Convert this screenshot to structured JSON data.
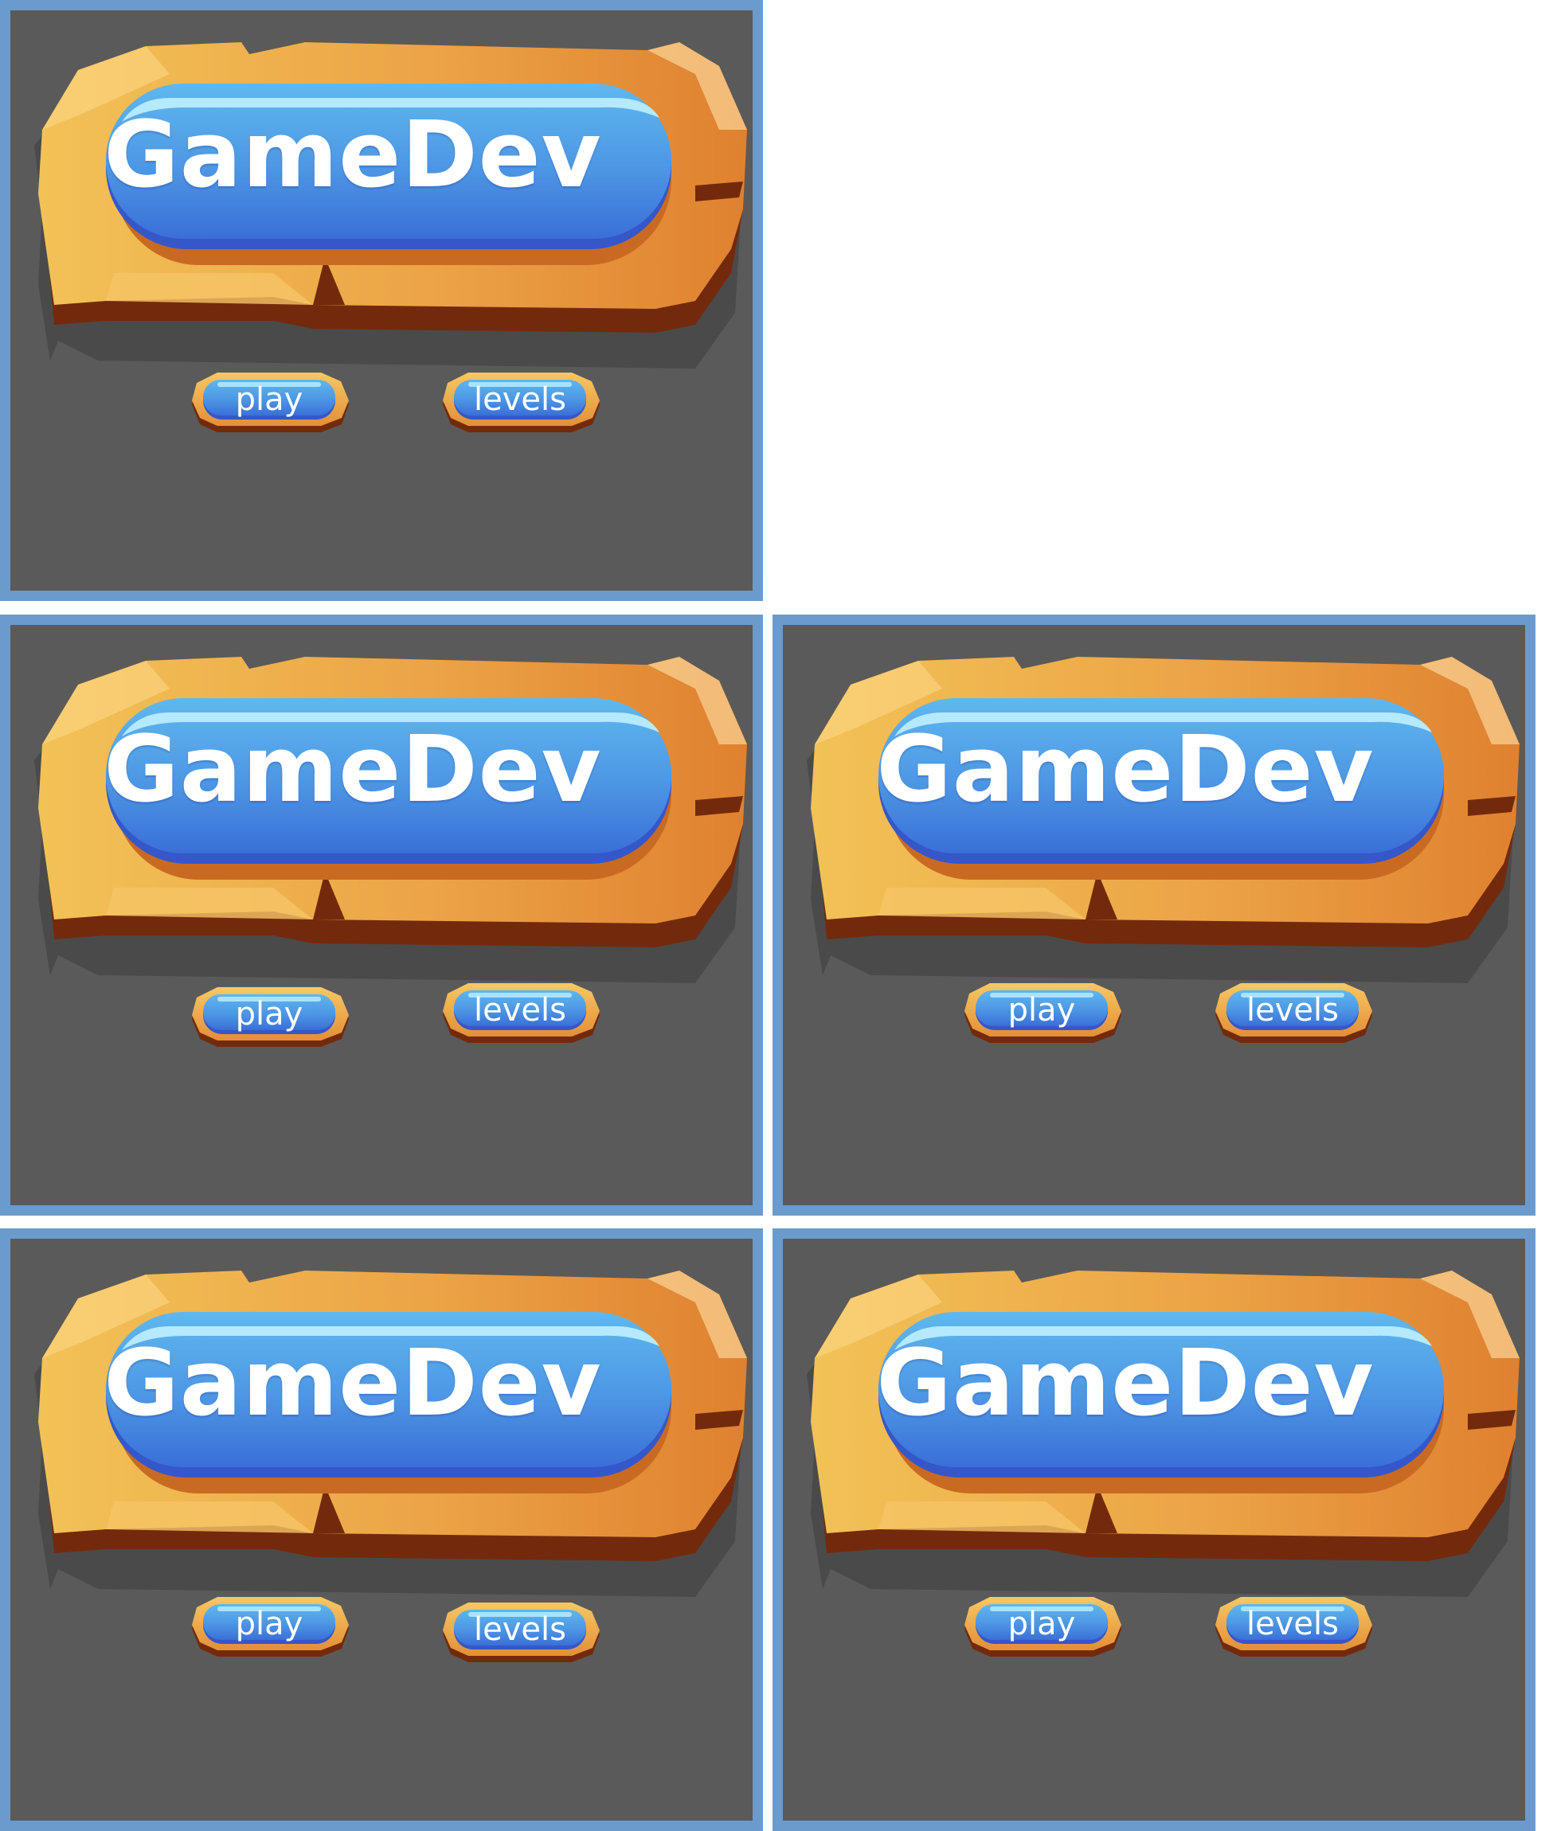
{
  "colors": {
    "panel_background": "#5a5a5a",
    "panel_border": "#6b9bcc",
    "stone_light": "#f2b84e",
    "stone_dark": "#e0852e",
    "stone_shadow": "#732a0c",
    "pill_blue": "#4a8fe0",
    "pill_highlight": "#8fd6ff"
  },
  "panels": [
    {
      "title": "GameDev",
      "play_label": "play",
      "levels_label": "levels"
    },
    {
      "title": "GameDev",
      "play_label": "play",
      "levels_label": "levels"
    },
    {
      "title": "GameDev",
      "play_label": "play",
      "levels_label": "levels"
    },
    {
      "title": "GameDev",
      "play_label": "play",
      "levels_label": "levels"
    },
    {
      "title": "GameDev",
      "play_label": "play",
      "levels_label": "levels"
    }
  ]
}
